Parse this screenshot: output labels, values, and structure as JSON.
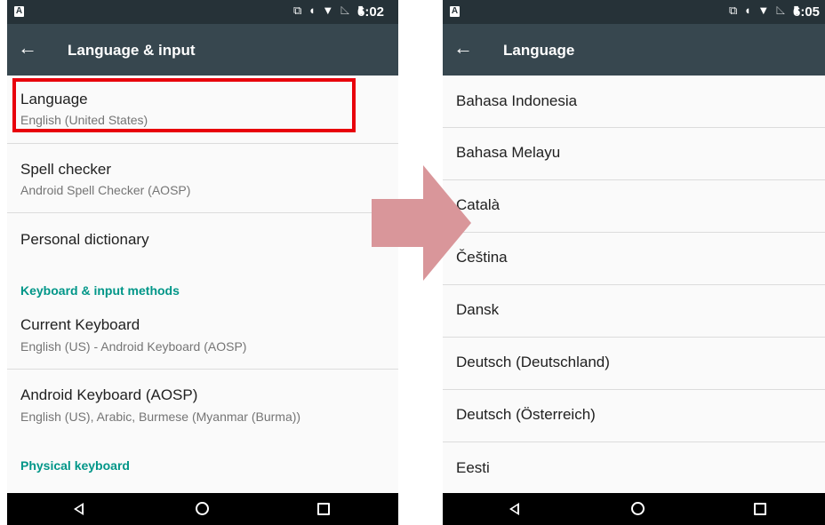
{
  "left_screen": {
    "status_time": "6:02",
    "status_icons": "⧉ ◖ ▼ ◺ ▮",
    "title": "Language & input",
    "items": [
      {
        "title": "Language",
        "subtitle": "English (United States)"
      },
      {
        "title": "Spell checker",
        "subtitle": "Android Spell Checker (AOSP)"
      },
      {
        "title": "Personal dictionary"
      },
      {
        "category": "Keyboard & input methods"
      },
      {
        "title": "Current Keyboard",
        "subtitle": "English (US) - Android Keyboard (AOSP)"
      },
      {
        "title": "Android Keyboard (AOSP)",
        "subtitle": "English (US), Arabic, Burmese (Myanmar (Burma))"
      },
      {
        "category": "Physical keyboard"
      }
    ]
  },
  "right_screen": {
    "status_time": "6:05",
    "status_icons": "⧉ ◖ ▼ ◺ ▮",
    "title": "Language",
    "languages": [
      "Bahasa Indonesia",
      "Bahasa Melayu",
      "Català",
      "Čeština",
      "Dansk",
      "Deutsch (Deutschland)",
      "Deutsch (Österreich)",
      "Eesti"
    ]
  },
  "colors": {
    "status_bar": "#263238",
    "app_bar": "#37474f",
    "accent": "#009688",
    "highlight": "#e8000b",
    "arrow": "#d9969a"
  },
  "icons": {
    "back": "arrow-left-icon",
    "nav_back": "triangle-back-icon",
    "nav_home": "circle-home-icon",
    "nav_recent": "square-recents-icon"
  }
}
